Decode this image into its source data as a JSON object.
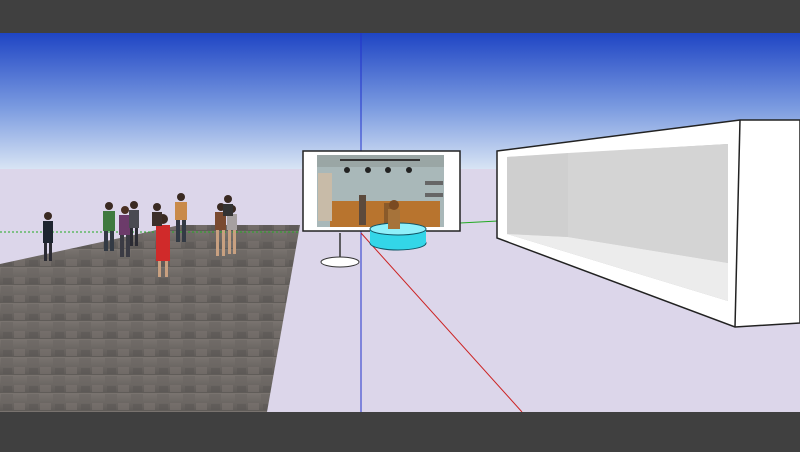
{
  "app": {
    "type": "3d-modeling-viewport"
  },
  "scene": {
    "colors": {
      "sky_top": "#1f45c4",
      "sky_bottom": "#d8e4f4",
      "ground": "#dcd6ea",
      "plaza": "#6f6a66",
      "axis_red": "#cc2222",
      "axis_green": "#22aa22",
      "axis_blue": "#2233cc",
      "pool_cyan": "#33d6e8",
      "building_white": "#ffffff"
    },
    "icons": [
      "walking-people-group",
      "kiosk-booth",
      "round-cyan-counter",
      "open-white-box-building",
      "axis-lines"
    ]
  }
}
